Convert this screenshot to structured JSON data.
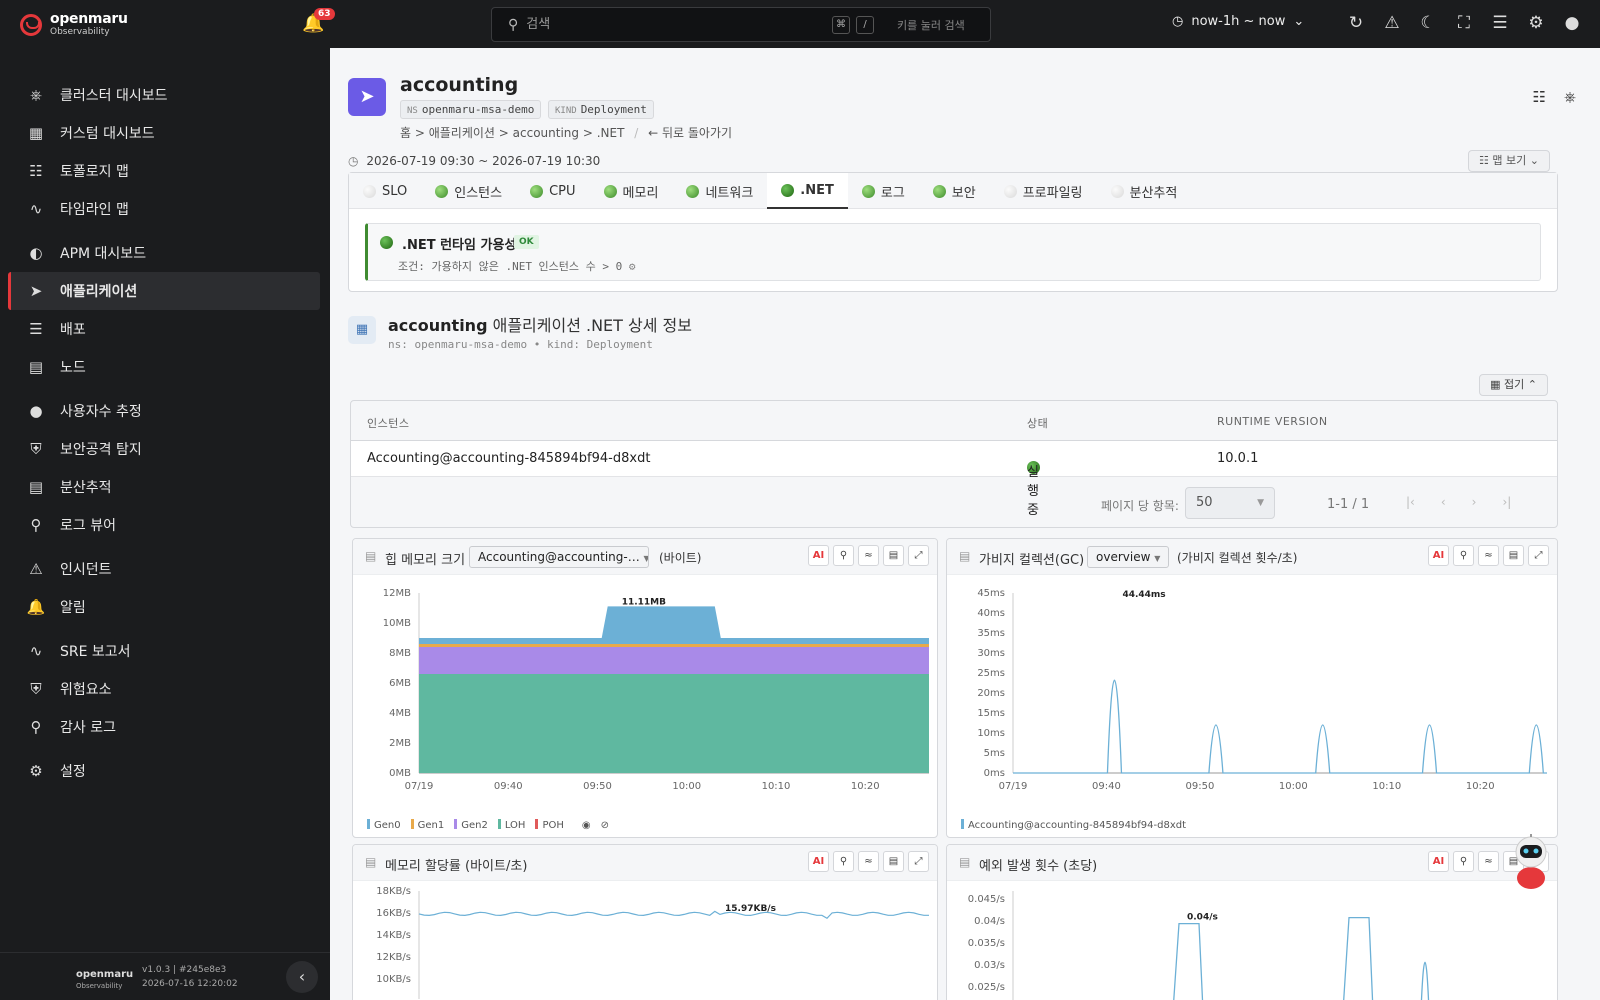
{
  "brand": {
    "name": "openmaru",
    "sub": "Observability"
  },
  "topbar": {
    "bell_count": "63",
    "search_placeholder": "검색",
    "kbd1": "⌘",
    "kbd2": "/",
    "search_hint": "키를 눌러 검색",
    "timerange": "now-1h ~ now"
  },
  "sidebar": {
    "items": [
      {
        "label": "클러스터 대시보드",
        "icon": "cluster-icon"
      },
      {
        "label": "커스텀 대시보드",
        "icon": "dashboard-icon"
      },
      {
        "label": "토폴로지 맵",
        "icon": "topology-icon"
      },
      {
        "label": "타임라인 맵",
        "icon": "timeline-icon"
      },
      {
        "label": "APM 대시보드",
        "icon": "gauge-icon"
      },
      {
        "label": "애플리케이션",
        "icon": "rocket-icon"
      },
      {
        "label": "배포",
        "icon": "layers-icon"
      },
      {
        "label": "노드",
        "icon": "server-icon"
      },
      {
        "label": "사용자수 추정",
        "icon": "users-icon"
      },
      {
        "label": "보안공격 탐지",
        "icon": "shield-icon"
      },
      {
        "label": "분산추적",
        "icon": "trace-icon"
      },
      {
        "label": "로그 뷰어",
        "icon": "log-icon"
      },
      {
        "label": "인시던트",
        "icon": "warning-icon"
      },
      {
        "label": "알림",
        "icon": "alert-bell-icon"
      },
      {
        "label": "SRE 보고서",
        "icon": "report-icon"
      },
      {
        "label": "위험요소",
        "icon": "lock-shield-icon"
      },
      {
        "label": "감사 로그",
        "icon": "audit-icon"
      },
      {
        "label": "설정",
        "icon": "gear-icon"
      }
    ],
    "active_index": 5,
    "footer_brand": "openmaru",
    "footer_brand_sub": "Observability",
    "version": "v1.0.3 | #245e8e3",
    "build_date": "2026-07-16 12:20:02"
  },
  "app": {
    "title": "accounting",
    "ns_key": "NS",
    "ns_value": "openmaru-msa-demo",
    "kind_key": "KIND",
    "kind_value": "Deployment",
    "breadcrumb": "홈 > 애플리케이션 > accounting > .NET",
    "back": "← 뒤로 돌아가기",
    "time": "2026-07-19 09:30 ~ 2026-07-19 10:30",
    "map_button": "맵 보기"
  },
  "tabs": [
    {
      "label": "SLO",
      "status": "grey"
    },
    {
      "label": "인스턴스",
      "status": "green"
    },
    {
      "label": "CPU",
      "status": "green"
    },
    {
      "label": "메모리",
      "status": "green"
    },
    {
      "label": "네트워크",
      "status": "green"
    },
    {
      "label": ".NET",
      "status": "dkgreen",
      "active": true
    },
    {
      "label": "로그",
      "status": "green"
    },
    {
      "label": "보안",
      "status": "green"
    },
    {
      "label": "프로파일링",
      "status": "grey"
    },
    {
      "label": "분산추적",
      "status": "grey"
    }
  ],
  "status_card": {
    "title": ".NET 런타임 가용성",
    "badge": "OK",
    "condition": "조건: 가용하지 않은 .NET 인스턴스 수 > 0"
  },
  "section": {
    "title_bold": "accounting",
    "title_rest": " 애플리케이션 .NET 상세 정보",
    "subtitle": "ns: openmaru-msa-demo • kind: Deployment",
    "fold_button": "접기"
  },
  "table": {
    "columns": [
      "인스턴스",
      "상태",
      "RUNTIME VERSION"
    ],
    "rows": [
      {
        "instance": "Accounting@accounting-845894bf94-d8xdt",
        "status": "실행중",
        "version": "10.0.1"
      }
    ],
    "page_size_label": "페이지 당 항목:",
    "page_size": "50",
    "range": "1-1 / 1"
  },
  "panels": {
    "heap": {
      "title": "힙 메모리 크기",
      "select": "Accounting@accounting-…",
      "unit": "(바이트)",
      "peak_label": "11.11MB"
    },
    "gc": {
      "title": "가비지 컬렉션(GC)",
      "select": "overview",
      "unit": "(가비지 컬렉션 횟수/초)",
      "peak_label": "44.44ms",
      "legend": "Accounting@accounting-845894bf94-d8xdt"
    },
    "alloc": {
      "title": "메모리 할당률 (바이트/초)",
      "peak_label": "15.97KB/s"
    },
    "exc": {
      "title": "예외 발생 횟수 (초당)",
      "peak_label": "0.04/s"
    }
  },
  "chart_data": [
    {
      "type": "area",
      "title": "힙 메모리 크기",
      "x": [
        "07/19",
        "09:40",
        "09:50",
        "10:00",
        "10:10",
        "10:20"
      ],
      "y_ticks": [
        "0MB",
        "2MB",
        "4MB",
        "6MB",
        "8MB",
        "10MB",
        "12MB"
      ],
      "ylim": [
        0,
        12
      ],
      "legend": [
        "Gen0",
        "Gen1",
        "Gen2",
        "LOH",
        "POH"
      ],
      "colors": {
        "Gen0": "#6cb0d6",
        "Gen1": "#e8a94a",
        "Gen2": "#a98ae8",
        "LOH": "#5fb8a0",
        "POH": "#e05a5a"
      },
      "stack_levels": {
        "LOH": 6.6,
        "Gen2": 8.4,
        "Gen1": 8.6,
        "Gen0": 9.0
      },
      "peak": 11.11
    },
    {
      "type": "line",
      "title": "가비지 컬렉션(GC)",
      "x": [
        "07/19",
        "09:40",
        "09:50",
        "10:00",
        "10:10",
        "10:20"
      ],
      "y_ticks": [
        "0ms",
        "5ms",
        "10ms",
        "15ms",
        "20ms",
        "25ms",
        "30ms",
        "35ms",
        "40ms",
        "45ms"
      ],
      "ylim": [
        0,
        45
      ],
      "spikes": [
        44.44,
        22,
        22,
        22,
        22
      ],
      "color": "#6cb0d6"
    },
    {
      "type": "line",
      "title": "메모리 할당률 (바이트/초)",
      "y_ticks": [
        "10KB/s",
        "12KB/s",
        "14KB/s",
        "16KB/s",
        "18KB/s"
      ],
      "peak": 15.97
    },
    {
      "type": "line",
      "title": "예외 발생 횟수 (초당)",
      "y_ticks": [
        "0.025/s",
        "0.03/s",
        "0.035/s",
        "0.04/s",
        "0.045/s"
      ],
      "peak": 0.04
    }
  ]
}
